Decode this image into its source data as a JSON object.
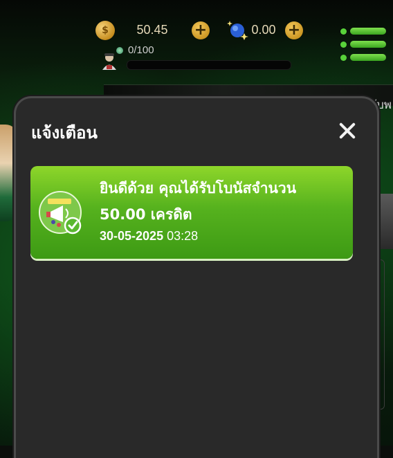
{
  "topbar": {
    "coin_balance": "50.45",
    "coin_symbol": "$",
    "gem_balance": "0.00",
    "plus_label": "+",
    "xp_text": "0/100"
  },
  "background": {
    "partial_text": "ำ ร้ บรับพ"
  },
  "modal": {
    "title": "แจ้งเตือน",
    "close_label": "✕"
  },
  "notification": {
    "title": "ยินดีด้วย คุณได้รับโบนัสจำนวน",
    "amount": "50.00 เครดิต",
    "date": "30-05-2025",
    "time": "03:28",
    "icon": "megaphone-badge-icon",
    "status_icon": "check-circle-icon"
  },
  "colors": {
    "card_green_top": "#8ed62a",
    "card_green_bottom": "#3d9a14",
    "modal_bg": "#292929",
    "gold": "#c99420"
  }
}
